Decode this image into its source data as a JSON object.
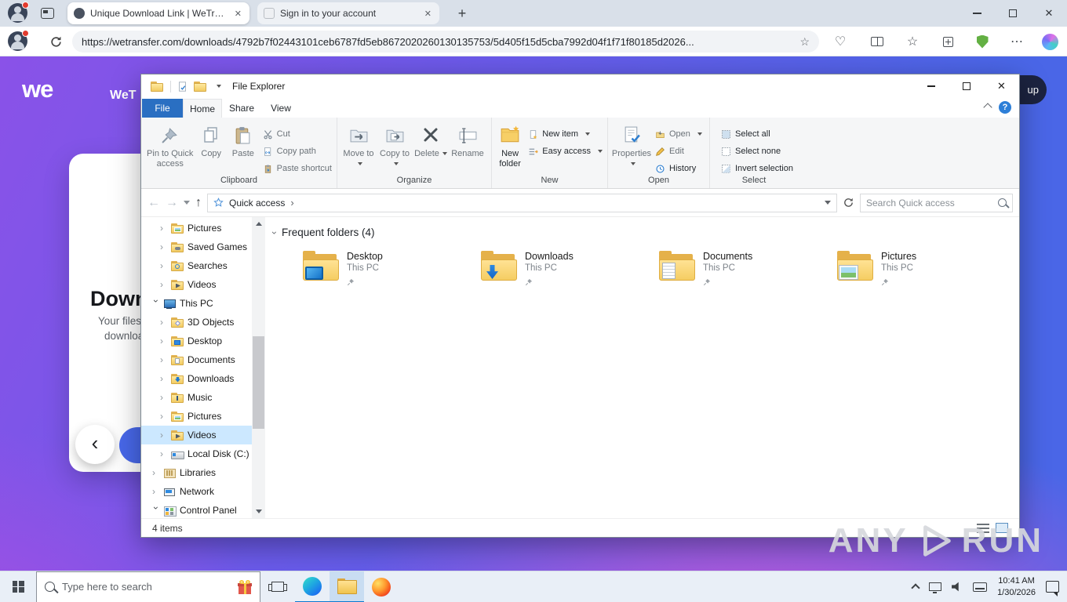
{
  "browser": {
    "tabs": [
      {
        "title": "Unique Download Link | WeTransf",
        "cls": "active",
        "icon": "wetransfer-favicon"
      },
      {
        "title": "Sign in to your account",
        "cls": "inactive",
        "icon": "signin-favicon"
      }
    ],
    "url": "https://wetransfer.com/downloads/4792b7f02443101ceb6787fd5eb8672020260130135753/5d405f15d5cba7992d04f1f71f80185d2026..."
  },
  "wetransfer_page": {
    "logo": "we",
    "brand_partial": "WeT",
    "heading_partial": "Downl",
    "subtext_line1": "Your files",
    "subtext_line2": "downloa",
    "signup_partial": "up"
  },
  "explorer": {
    "window_title": "File Explorer",
    "menu": {
      "file": "File",
      "home": "Home",
      "share": "Share",
      "view": "View"
    },
    "ribbon": {
      "pin": "Pin to Quick access",
      "copy": "Copy",
      "paste": "Paste",
      "cut": "Cut",
      "copy_path": "Copy path",
      "paste_shortcut": "Paste shortcut",
      "move_to": "Move to",
      "copy_to": "Copy to",
      "del": "Delete",
      "rename": "Rename",
      "new_folder": "New folder",
      "new_item": "New item",
      "easy_access": "Easy access",
      "properties": "Properties",
      "open": "Open",
      "edit": "Edit",
      "history": "History",
      "select_all": "Select all",
      "select_none": "Select none",
      "invert_selection": "Invert selection",
      "groups": {
        "clipboard": "Clipboard",
        "organize": "Organize",
        "new": "New",
        "open": "Open",
        "select": "Select"
      }
    },
    "address": {
      "root": "Quick access",
      "search_placeholder": "Search Quick access"
    },
    "tree": [
      {
        "label": "Pictures",
        "icon": "f pics",
        "cls": "lvl1"
      },
      {
        "label": "Saved Games",
        "icon": "f games",
        "cls": "lvl1"
      },
      {
        "label": "Searches",
        "icon": "f srch",
        "cls": "lvl1"
      },
      {
        "label": "Videos",
        "icon": "f vids",
        "cls": "lvl1"
      },
      {
        "label": "This PC",
        "icon": "pc",
        "cls": "lvl0 exp"
      },
      {
        "label": "3D Objects",
        "icon": "f o3d",
        "cls": "lvl1"
      },
      {
        "label": "Desktop",
        "icon": "f desk",
        "cls": "lvl1"
      },
      {
        "label": "Documents",
        "icon": "f docs",
        "cls": "lvl1"
      },
      {
        "label": "Downloads",
        "icon": "f dl",
        "cls": "lvl1"
      },
      {
        "label": "Music",
        "icon": "f mus",
        "cls": "lvl1"
      },
      {
        "label": "Pictures",
        "icon": "f pics",
        "cls": "lvl1"
      },
      {
        "label": "Videos",
        "icon": "f vids",
        "cls": "lvl1 sel"
      },
      {
        "label": "Local Disk (C:)",
        "icon": "disk",
        "cls": "lvl1"
      },
      {
        "label": "Libraries",
        "icon": "lib",
        "cls": "lvl0"
      },
      {
        "label": "Network",
        "icon": "net",
        "cls": "lvl0"
      },
      {
        "label": "Control Panel",
        "icon": "cpl",
        "cls": "lvl0 exp"
      }
    ],
    "content": {
      "section_header": "Frequent folders (4)",
      "folders": [
        {
          "name": "Desktop",
          "location": "This PC",
          "icon": "ov-desktop"
        },
        {
          "name": "Downloads",
          "location": "This PC",
          "icon": "ov-downloads"
        },
        {
          "name": "Documents",
          "location": "This PC",
          "icon": "ov-documents"
        },
        {
          "name": "Pictures",
          "location": "This PC",
          "icon": "ov-pictures"
        }
      ]
    },
    "status": {
      "items": "4 items"
    }
  },
  "taskbar": {
    "search_placeholder": "Type here to search",
    "time": "10:41 AM",
    "date": "1/30/2026"
  },
  "watermark": {
    "left": "ANY",
    "right": "RUN"
  }
}
